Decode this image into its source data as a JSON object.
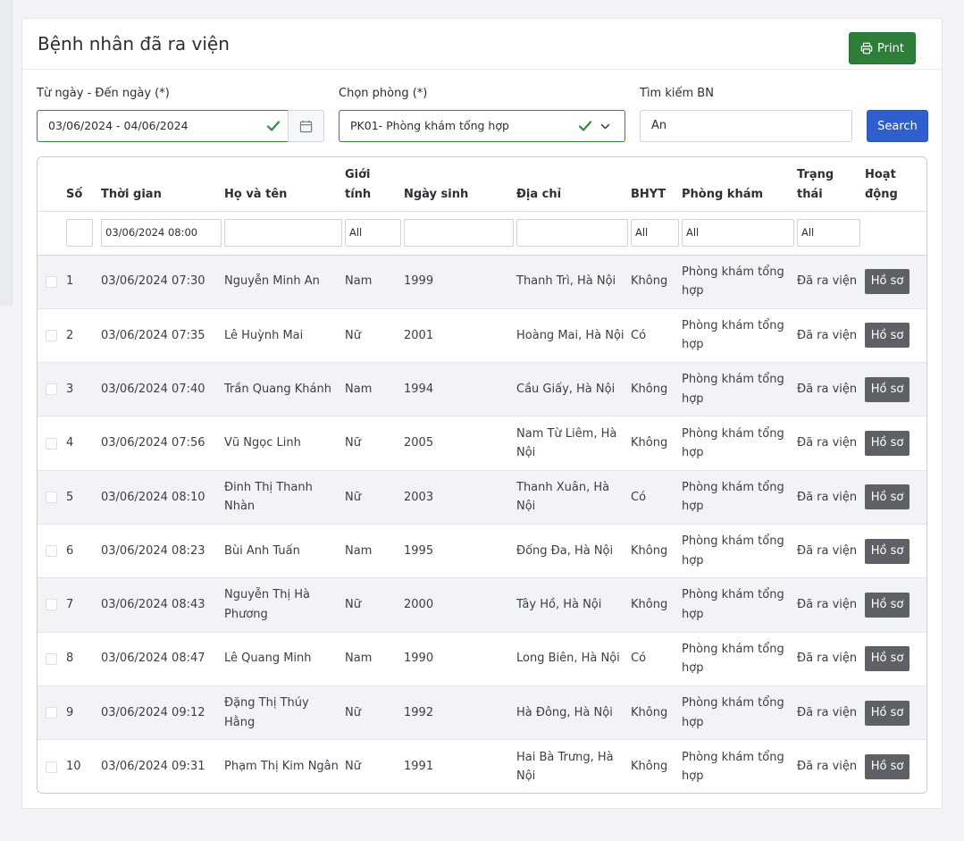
{
  "page": {
    "title": "Bệnh nhân đã ra viện",
    "print_label": "Print"
  },
  "filters": {
    "date_label": "Từ ngày - Đến ngày (*)",
    "date_value": "03/06/2024 - 04/06/2024",
    "room_label": "Chọn phòng (*)",
    "room_value": "PK01- Phòng khám tổng hợp",
    "search_label": "Tìm kiếm BN",
    "search_value": "An",
    "search_button": "Search"
  },
  "table": {
    "headers": {
      "so": "Số",
      "thoi_gian": "Thời gian",
      "ho_ten": "Họ và tên",
      "gioi_tinh_1": "Giới",
      "gioi_tinh_2": "tính",
      "ngay_sinh": "Ngày sinh",
      "dia_chi": "Địa chỉ",
      "bhyt": "BHYT",
      "phong_kham": "Phòng khám",
      "trang_thai_1": "Trạng",
      "trang_thai_2": "thái",
      "hoat_dong_1": "Hoạt",
      "hoat_dong_2": "động"
    },
    "filter_row": {
      "so": "",
      "thoi_gian": "03/06/2024 08:00",
      "ho_ten": "",
      "gioi_tinh": "All",
      "ngay_sinh": "",
      "dia_chi": "",
      "bhyt": "All",
      "phong_kham": "All",
      "trang_thai": "All"
    },
    "action_label": "Hồ sơ",
    "rows": [
      {
        "so": "1",
        "time": "03/06/2024 07:30",
        "name": "Nguyễn Minh An",
        "gender": "Nam",
        "dob": "1999",
        "address": "Thanh Trì, Hà Nội",
        "bhyt": "Không",
        "room": "Phòng khám tổng hợp",
        "status": "Đã ra viện"
      },
      {
        "so": "2",
        "time": "03/06/2024 07:35",
        "name": "Lê Huỳnh Mai",
        "gender": "Nữ",
        "dob": "2001",
        "address": "Hoàng Mai, Hà Nội",
        "bhyt": "Có",
        "room": "Phòng khám tổng hợp",
        "status": "Đã ra viện"
      },
      {
        "so": "3",
        "time": "03/06/2024 07:40",
        "name": "Trần Quang Khánh",
        "gender": "Nam",
        "dob": "1994",
        "address": "Cầu Giấy, Hà Nội",
        "bhyt": "Không",
        "room": "Phòng khám tổng hợp",
        "status": "Đã ra viện"
      },
      {
        "so": "4",
        "time": "03/06/2024 07:56",
        "name": "Vũ Ngọc Linh",
        "gender": "Nữ",
        "dob": "2005",
        "address": "Nam Từ Liêm, Hà Nội",
        "bhyt": "Không",
        "room": "Phòng khám tổng hợp",
        "status": "Đã ra viện"
      },
      {
        "so": "5",
        "time": "03/06/2024 08:10",
        "name": "Đinh Thị Thanh Nhàn",
        "gender": "Nữ",
        "dob": "2003",
        "address": "Thanh Xuân, Hà Nội",
        "bhyt": "Có",
        "room": "Phòng khám tổng hợp",
        "status": "Đã ra viện"
      },
      {
        "so": "6",
        "time": "03/06/2024 08:23",
        "name": "Bùi Anh Tuấn",
        "gender": "Nam",
        "dob": "1995",
        "address": "Đống Đa, Hà Nội",
        "bhyt": "Không",
        "room": "Phòng khám tổng hợp",
        "status": "Đã ra viện"
      },
      {
        "so": "7",
        "time": "03/06/2024 08:43",
        "name": "Nguyễn Thị Hà Phương",
        "gender": "Nữ",
        "dob": "2000",
        "address": "Tây Hồ, Hà Nội",
        "bhyt": "Không",
        "room": "Phòng khám tổng hợp",
        "status": "Đã ra viện"
      },
      {
        "so": "8",
        "time": "03/06/2024 08:47",
        "name": "Lê Quang Minh",
        "gender": "Nam",
        "dob": "1990",
        "address": "Long Biên, Hà Nội",
        "bhyt": "Có",
        "room": "Phòng khám tổng hợp",
        "status": "Đã ra viện"
      },
      {
        "so": "9",
        "time": "03/06/2024 09:12",
        "name": "Đặng Thị Thúy Hằng",
        "gender": "Nữ",
        "dob": "1992",
        "address": "Hà Đông, Hà Nội",
        "bhyt": "Không",
        "room": "Phòng khám tổng hợp",
        "status": "Đã ra viện"
      },
      {
        "so": "10",
        "time": "03/06/2024 09:31",
        "name": "Phạm Thị Kim Ngân",
        "gender": "Nữ",
        "dob": "1991",
        "address": "Hai Bà Trưng, Hà Nội",
        "bhyt": "Không",
        "room": "Phòng khám tổng hợp",
        "status": "Đã ra viện"
      }
    ]
  },
  "colors": {
    "print_button": "#2f7d3a",
    "search_button": "#2f5ecf",
    "valid_border": "#2f8a3e",
    "action_button": "#5d6166"
  }
}
